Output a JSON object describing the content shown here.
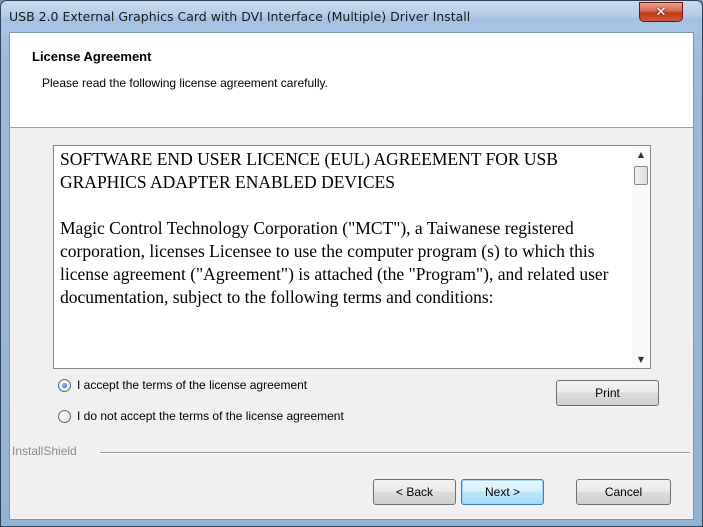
{
  "window": {
    "title": "USB 2.0 External Graphics Card with DVI Interface (Multiple) Driver Install",
    "close_icon": "close-icon",
    "close_glyph": "✕"
  },
  "header": {
    "title": "License Agreement",
    "subtitle": "Please read the following license agreement carefully."
  },
  "license": {
    "paragraphs": [
      "SOFTWARE END USER LICENCE (EUL) AGREEMENT FOR USB GRAPHICS ADAPTER ENABLED DEVICES",
      "Magic Control Technology Corporation (\"MCT\"), a Taiwanese registered corporation, licenses Licensee to use the computer program (s) to which this license agreement (\"Agreement\") is attached (the \"Program\"), and related user documentation, subject to the following terms and conditions:"
    ],
    "scroll_up_glyph": "▲",
    "scroll_down_glyph": "▼"
  },
  "options": {
    "accept_label": "I accept the terms of the license agreement",
    "decline_label": "I do not accept the terms of the license agreement",
    "selected": "accept"
  },
  "buttons": {
    "print": "Print",
    "back": "< Back",
    "next": "Next >",
    "cancel": "Cancel"
  },
  "footer": {
    "brand": "InstallShield"
  },
  "colors": {
    "title_bar": "#a9c6e6",
    "close_button": "#c0391c",
    "default_button_border": "#3c7fb1"
  }
}
